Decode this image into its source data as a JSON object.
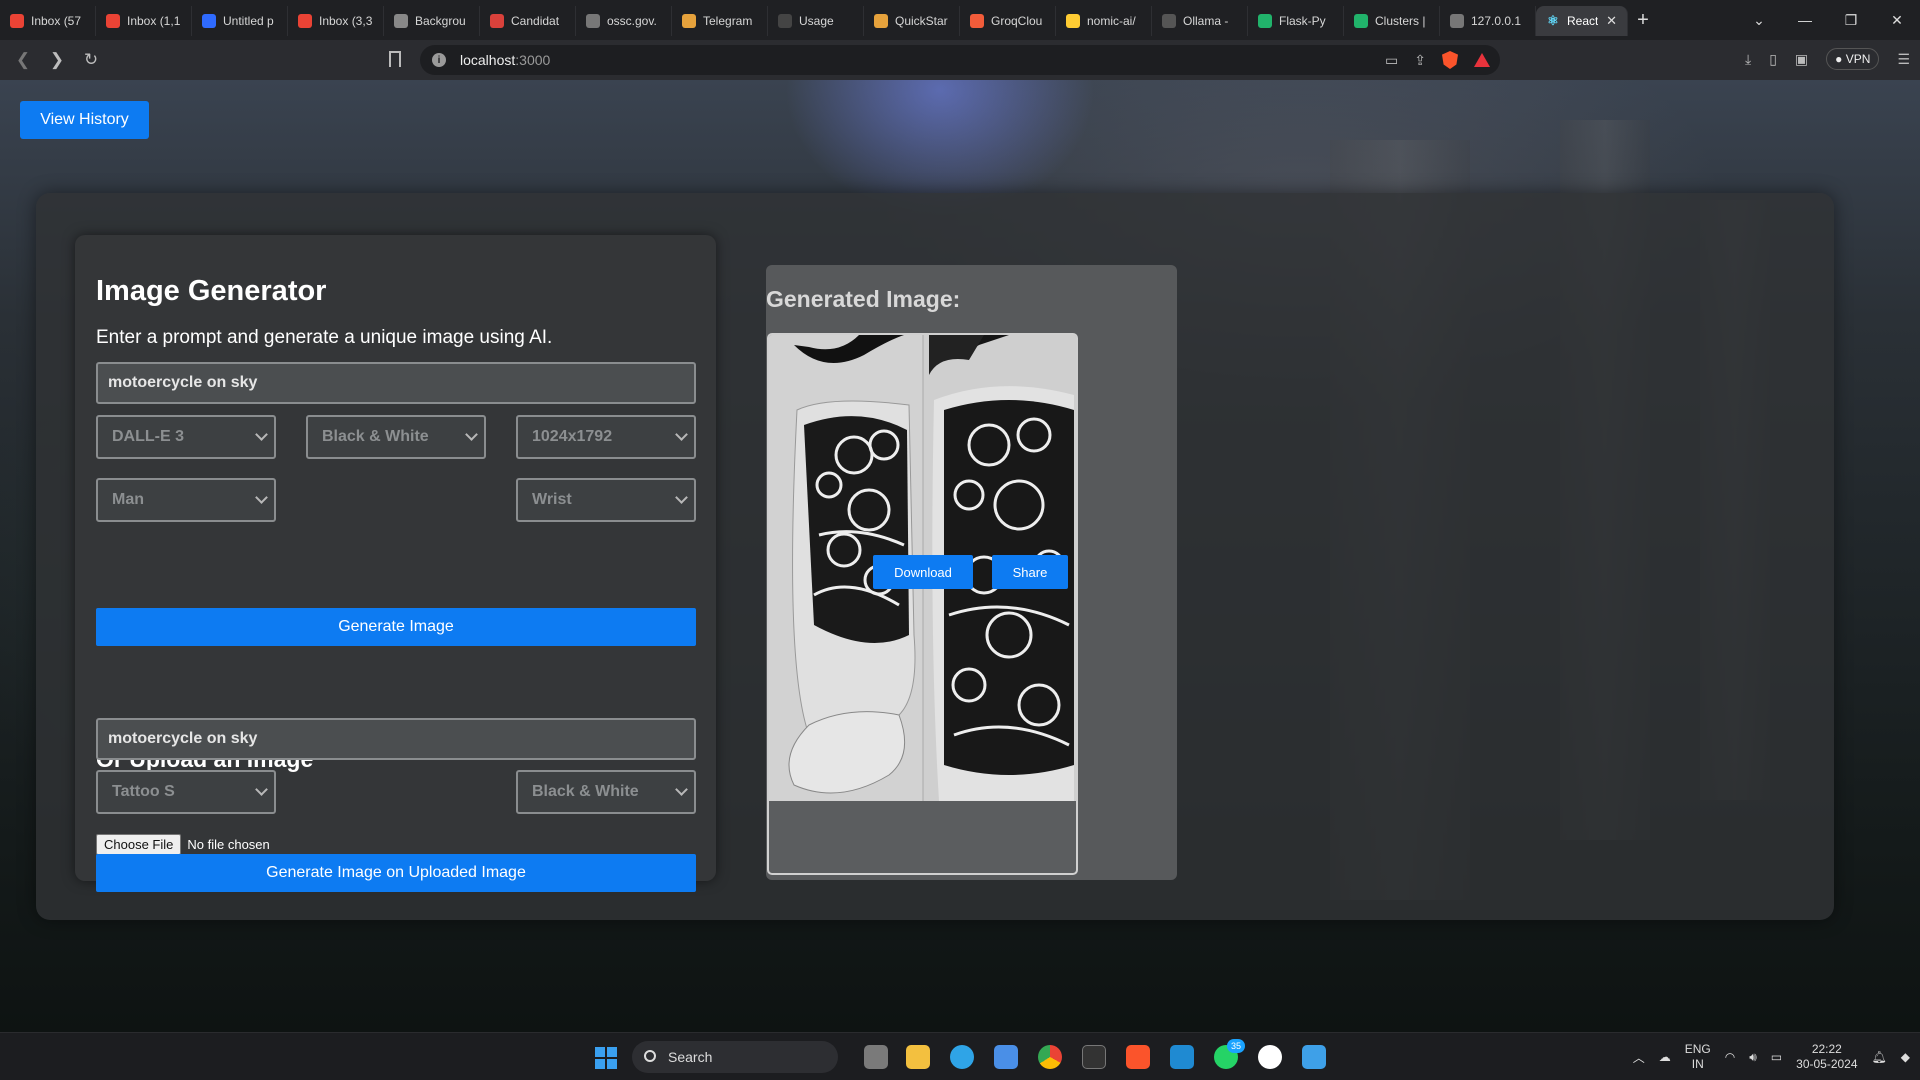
{
  "browser": {
    "tabs": [
      {
        "label": "Inbox (57",
        "favicon": "gmail-icon",
        "color": "#ea4335"
      },
      {
        "label": "Inbox (1,1",
        "favicon": "gmail-icon",
        "color": "#ea4335"
      },
      {
        "label": "Untitled p",
        "favicon": "workspace-icon",
        "color": "#2f6bff"
      },
      {
        "label": "Inbox (3,3",
        "favicon": "gmail-icon",
        "color": "#ea4335"
      },
      {
        "label": "Backgrou",
        "favicon": "box-icon",
        "color": "#888888"
      },
      {
        "label": "Candidat",
        "favicon": "doc-icon",
        "color": "#d9413b"
      },
      {
        "label": "ossc.gov.",
        "favicon": "globe-icon",
        "color": "#777777"
      },
      {
        "label": "Telegram",
        "favicon": "loop-icon",
        "color": "#e6a23c"
      },
      {
        "label": "Usage",
        "favicon": "usage-icon",
        "color": "#444444"
      },
      {
        "label": "QuickStar",
        "favicon": "loop-icon",
        "color": "#e6a23c"
      },
      {
        "label": "GroqClou",
        "favicon": "groq-icon",
        "color": "#f25c3a"
      },
      {
        "label": "nomic-ai/",
        "favicon": "hf-icon",
        "color": "#ffcc33"
      },
      {
        "label": "Ollama - ",
        "favicon": "ollama-icon",
        "color": "#555555"
      },
      {
        "label": "Flask-Py",
        "favicon": "leaf-icon",
        "color": "#21b36b"
      },
      {
        "label": "Clusters |",
        "favicon": "leaf-icon",
        "color": "#21b36b"
      },
      {
        "label": "127.0.0.1",
        "favicon": "globe-icon",
        "color": "#777777"
      }
    ],
    "active_tab": {
      "label": "React",
      "favicon": "react-icon"
    },
    "url_host": "localhost",
    "url_port": ":3000",
    "vpn_label": "VPN"
  },
  "page": {
    "history_button": "View History",
    "generator": {
      "title": "Image Generator",
      "subtitle": "Enter a prompt and generate a unique image using AI.",
      "prompt_value": "motoercycle on sky",
      "model": "DALL-E 3",
      "style": "Black & White",
      "size": "1024x1792",
      "gender": "Man",
      "placement": "Wrist",
      "generate_button": "Generate Image"
    },
    "upload": {
      "title": "Or Upload an Image",
      "prompt_value": "motoercycle on sky",
      "type": "Tattoo S",
      "style": "Black & White",
      "choose_file": "Choose File",
      "no_file": "No file chosen",
      "generate_button": "Generate Image on Uploaded Image"
    },
    "result": {
      "title": "Generated Image:",
      "download_button": "Download",
      "share_button": "Share"
    }
  },
  "taskbar": {
    "search_label": "Search",
    "whatsapp_badge": "35",
    "lang": "ENG",
    "region": "IN",
    "time": "22:22",
    "date": "30-05-2024"
  }
}
